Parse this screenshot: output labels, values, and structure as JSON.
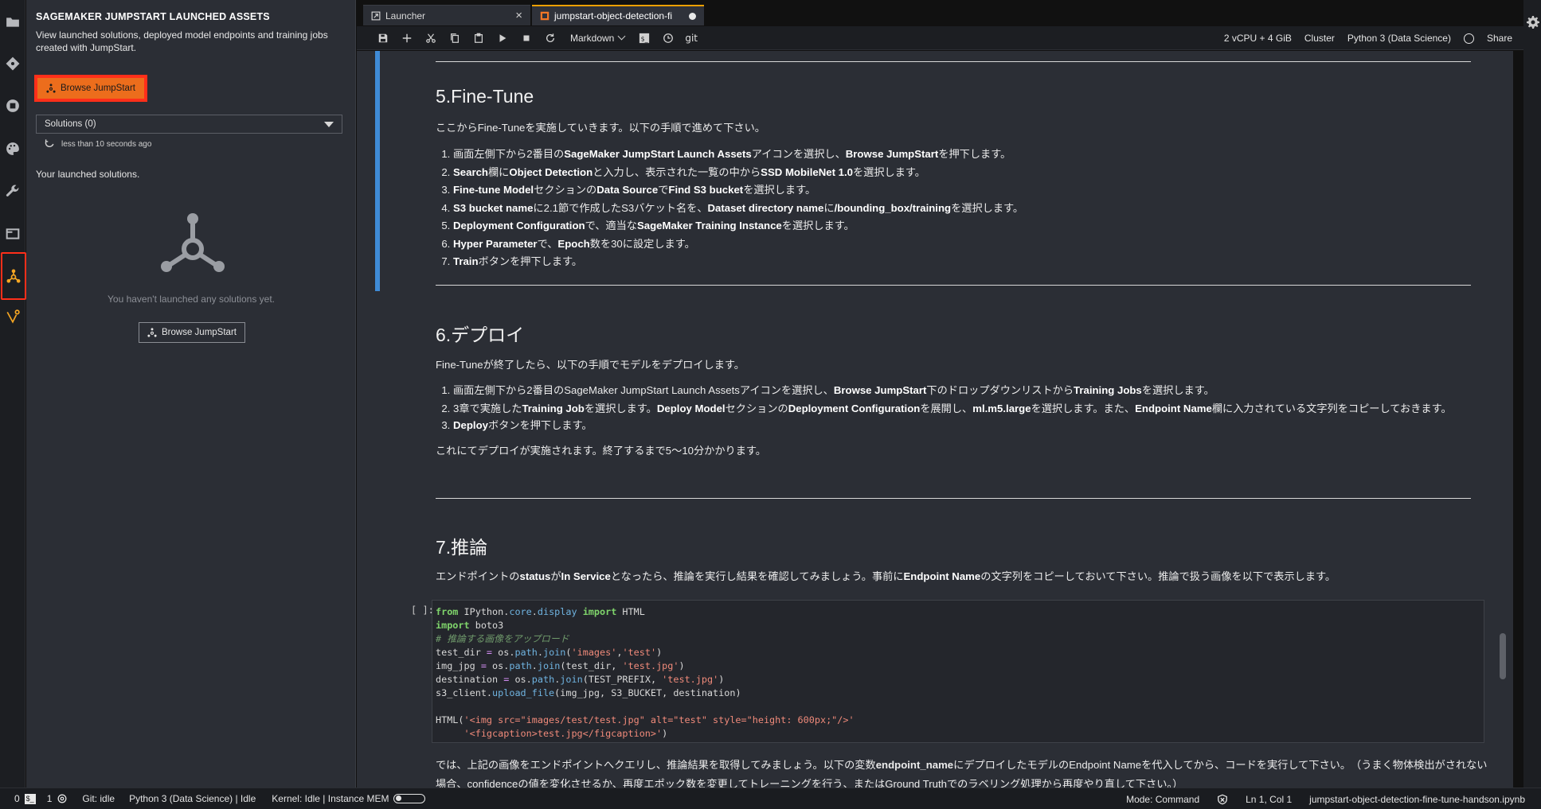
{
  "side_panel": {
    "title": "SAGEMAKER JUMPSTART LAUNCHED ASSETS",
    "description": "View launched solutions, deployed model endpoints and training jobs created with JumpStart.",
    "browse_button_label": "Browse JumpStart",
    "solutions_select_value": "Solutions (0)",
    "refresh_text": "less than 10 seconds ago",
    "launched_label": "Your launched solutions.",
    "empty_text": "You haven't launched any solutions yet.",
    "browse_button_outline_label": "Browse JumpStart"
  },
  "tabs": [
    {
      "label": "Launcher"
    },
    {
      "label": "jumpstart-object-detection-fi"
    }
  ],
  "toolbar": {
    "cell_type": "Markdown",
    "git_label": "git",
    "resources": "2 vCPU + 4 GiB",
    "cluster": "Cluster",
    "kernel": "Python 3 (Data Science)",
    "share": "Share"
  },
  "notebook": {
    "sec5": {
      "heading": "5.Fine-Tune",
      "intro": "ここからFine-Tuneを実施していきます。以下の手順で進めて下さい。",
      "steps": [
        [
          "画面左側下から2番目の",
          "SageMaker JumpStart Launch Assets",
          "アイコンを選択し、",
          "Browse JumpStart",
          "を押下します。"
        ],
        [
          "Search",
          "欄に",
          "Object Detection",
          "と入力し、表示された一覧の中から",
          "SSD MobileNet 1.0",
          "を選択します。"
        ],
        [
          "Fine-tune Model",
          "セクションの",
          "Data Source",
          "で",
          "Find S3 bucket",
          "を選択します。"
        ],
        [
          "S3 bucket name",
          "に2.1節で作成したS3バケット名を、",
          "Dataset directory name",
          "に",
          "/bounding_box/training",
          "を選択します。"
        ],
        [
          "Deployment Configuration",
          "で、適当な",
          "SageMaker Training Instance",
          "を選択します。"
        ],
        [
          "Hyper Parameter",
          "で、",
          "Epoch",
          "数を30に設定します。"
        ],
        [
          "Train",
          "ボタンを押下します。"
        ]
      ]
    },
    "sec6": {
      "heading": "6.デプロイ",
      "intro": "Fine-Tuneが終了したら、以下の手順でモデルをデプロイします。",
      "step1": [
        "画面左側下から2番目のSageMaker JumpStart Launch Assetsアイコンを選択し、",
        "Browse JumpStart",
        "下のドロップダウンリストから",
        "Training Jobs",
        "を選択します。"
      ],
      "step2": [
        "3章で実施した",
        "Training Job",
        "を選択します。",
        "Deploy Model",
        "セクションの",
        "Deployment Configuration",
        "を展開し、",
        "ml.m5.large",
        "を選択します。また、",
        "Endpoint Name",
        "欄に入力されている文字列をコピーしておきます。"
      ],
      "step3": [
        "Deploy",
        "ボタンを押下します。"
      ],
      "outro": "これにてデプロイが実施されます。終了するまで5～10分かかります。"
    },
    "sec7": {
      "heading": "7.推論",
      "intro": [
        "エンドポイントの",
        "status",
        "が",
        "In Service",
        "となったら、推論を実行し結果を確認してみましょう。事前に",
        "Endpoint Name",
        "の文字列をコピーしておいて下さい。推論で扱う画像を以下で表示します。"
      ]
    },
    "code_prompt": "[ ]:",
    "code_lines": [
      "from IPython.core.display import HTML",
      "import boto3",
      "# 推論する画像をアップロード",
      "test_dir = os.path.join('images','test')",
      "img_jpg = os.path.join(test_dir, 'test.jpg')",
      "destination = os.path.join(TEST_PREFIX, 'test.jpg')",
      "s3_client.upload_file(img_jpg, S3_BUCKET, destination)",
      "",
      "HTML('<img src=\"images/test/test.jpg\" alt=\"test\" style=\"height: 600px;\"/>'",
      "     '<figcaption>test.jpg</figcaption>')"
    ],
    "after_text": [
      "では、上記の画像をエンドポイントへクエリし、推論結果を取得してみましょう。以下の変数",
      "endpoint_name",
      "にデプロイしたモデルのEndpoint Nameを代入してから、コードを実行して下さい。　（うまく物体検出がされない場合、confidenceの値を変化させるか、再度エポック数を変更してトレーニングを行う、またはGround Truthでのラベリング処理から再度やり直して下さい。）"
    ]
  },
  "status_bar": {
    "count0": "0",
    "count1": "1",
    "git": "Git: idle",
    "kernel_status": "Python 3 (Data Science) | Idle",
    "kernel_mem": "Kernel: Idle | Instance MEM",
    "mode": "Mode: Command",
    "position": "Ln 1, Col 1",
    "filename": "jumpstart-object-detection-fine-tune-handson.ipynb"
  }
}
